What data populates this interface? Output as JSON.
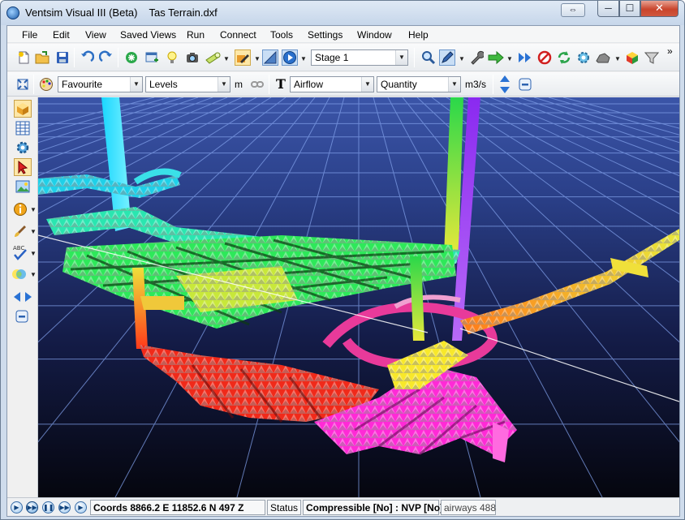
{
  "window": {
    "app_name": "Ventsim Visual III (Beta)",
    "document": "Tas Terrain.dxf",
    "sys_button": "⇔",
    "controls": {
      "minimize": "─",
      "maximize": "☐",
      "close": "✕"
    }
  },
  "menu": [
    "File",
    "Edit",
    "View",
    "Saved Views",
    "Run",
    "Connect",
    "Tools",
    "Settings",
    "Window",
    "Help"
  ],
  "toolbar1": {
    "stage": "Stage 1",
    "overflow": "»"
  },
  "toolbar2": {
    "favourite": "Favourite",
    "levels": "Levels",
    "levels_unit": "m",
    "text_icon": "T",
    "airflow": "Airflow",
    "quantity": "Quantity",
    "quantity_unit": "m3/s"
  },
  "status": {
    "coords": "Coords 8866.2 E    11852.6 N    497 Z",
    "status_label": "Status",
    "compressible": "Compressible [No] : NVP [No]",
    "airways": "airways 488"
  },
  "colors": {
    "sky_top": "#0a0d1c",
    "sky_horizon": "#3b55a8",
    "grid_line": "#7f9ee8",
    "accent": "#1a5ba8"
  },
  "icons": {
    "new": "new-file-icon",
    "open": "open-folder-icon",
    "save": "save-icon",
    "undo": "undo-icon",
    "redo": "redo-icon"
  }
}
